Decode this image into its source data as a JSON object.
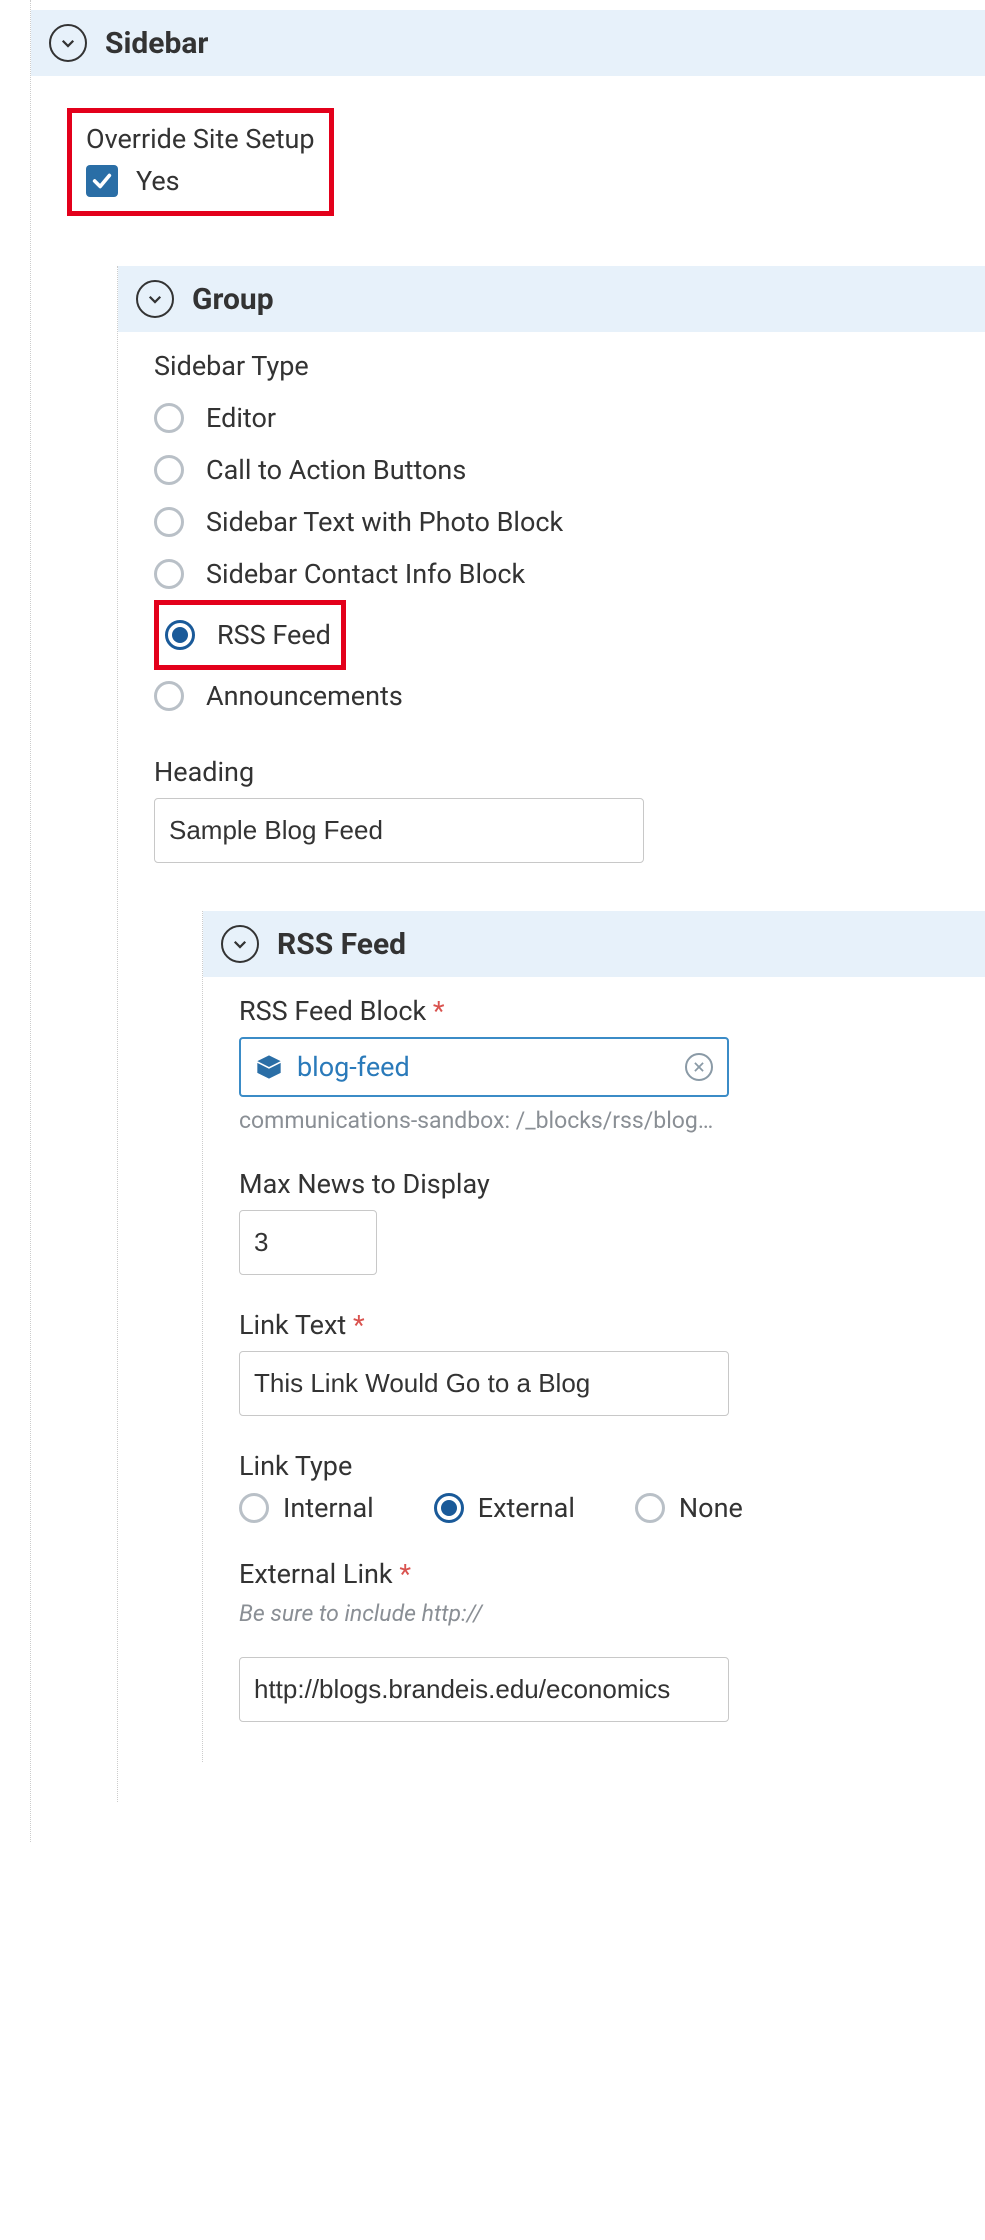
{
  "sidebar": {
    "title": "Sidebar",
    "override": {
      "label": "Override Site Setup",
      "yes": "Yes"
    }
  },
  "group": {
    "title": "Group",
    "sidebar_type": {
      "label": "Sidebar Type",
      "options": {
        "editor": "Editor",
        "cta": "Call to Action Buttons",
        "photo": "Sidebar Text with Photo Block",
        "contact": "Sidebar Contact Info Block",
        "rss": "RSS Feed",
        "announcements": "Announcements"
      }
    },
    "heading": {
      "label": "Heading",
      "value": "Sample Blog Feed"
    }
  },
  "rss": {
    "title": "RSS Feed",
    "block": {
      "label": "RSS Feed Block",
      "value": "blog-feed",
      "path": "communications-sandbox: /_blocks/rss/blog…"
    },
    "max": {
      "label": "Max News to Display",
      "value": "3"
    },
    "link_text": {
      "label": "Link Text",
      "value": "This Link Would Go to a Blog"
    },
    "link_type": {
      "label": "Link Type",
      "internal": "Internal",
      "external": "External",
      "none": "None"
    },
    "external_link": {
      "label": "External Link",
      "hint": "Be sure to include http://",
      "value": "http://blogs.brandeis.edu/economics"
    }
  }
}
